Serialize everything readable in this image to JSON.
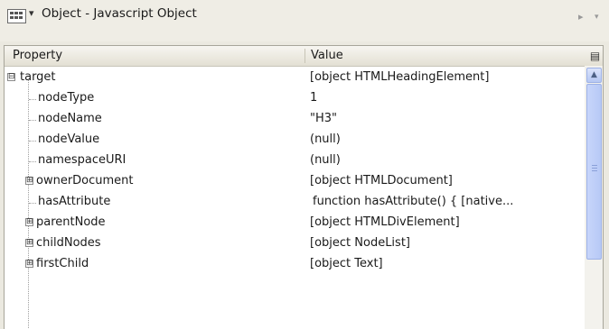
{
  "toolbar": {
    "title": "Object - Javascript Object"
  },
  "header": {
    "property": "Property",
    "value": "Value"
  },
  "rows": [
    {
      "name": "target",
      "value": "[object HTMLHeadingElement]",
      "expander": "⊟"
    },
    {
      "name": "nodeType",
      "value": "1"
    },
    {
      "name": "nodeName",
      "value": "\"H3\""
    },
    {
      "name": "nodeValue",
      "value": "(null)"
    },
    {
      "name": "namespaceURI",
      "value": "(null)"
    },
    {
      "name": "ownerDocument",
      "value": "[object HTMLDocument]",
      "expander": "⊞"
    },
    {
      "name": "hasAttribute",
      "value": "function hasAttribute() {    [native..."
    },
    {
      "name": "parentNode",
      "value": "[object HTMLDivElement]",
      "expander": "⊞"
    },
    {
      "name": "childNodes",
      "value": "[object NodeList]",
      "expander": "⊞"
    },
    {
      "name": "firstChild",
      "value": "[object Text]",
      "expander": "⊞"
    }
  ]
}
